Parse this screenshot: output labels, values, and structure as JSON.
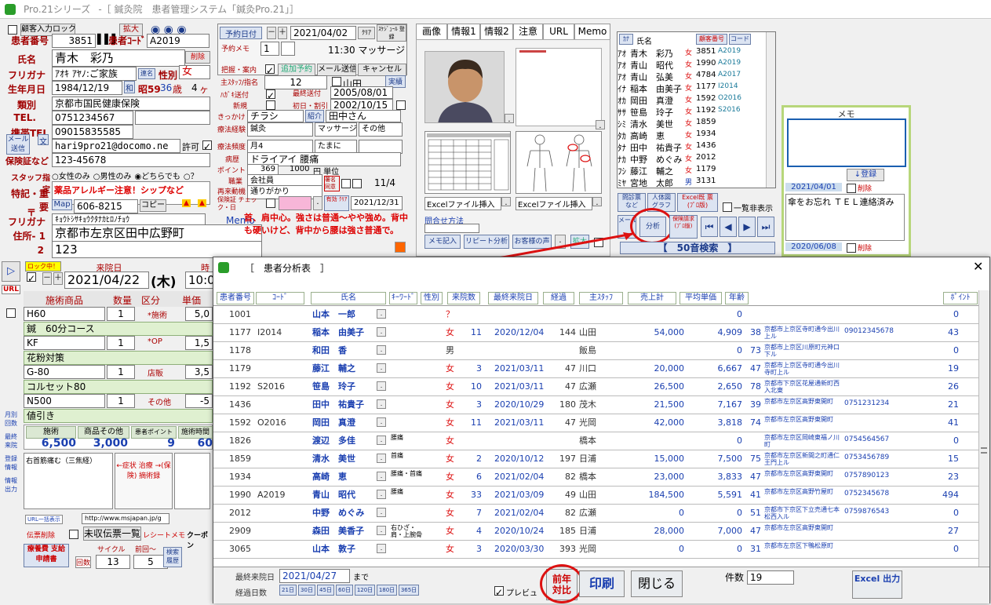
{
  "window": {
    "app": "Pro.21シリーズ",
    "title": "-［ 鍼灸院　患者管理システム「鍼灸Pro.21」］"
  },
  "patient": {
    "input_lock": "顧客入力ロック",
    "zoom": "拡大",
    "no_label": "患者番号",
    "no": "3851",
    "code_label": "患者ｺｰﾄﾞ",
    "code": "A2019",
    "name_label": "氏名",
    "name": "青木　彩乃",
    "delete": "削除",
    "kana_label": "フリガナ",
    "kana": "ｱｵｷ ｱﾔﾉ:ご家族",
    "family_btn": "連名",
    "sex_label": "性別",
    "sex": "女",
    "birth_label": "生年月日",
    "birth": "1984/12/19",
    "era_btn": "和",
    "era": "昭59",
    "age": "36",
    "age_unit": "歳",
    "months": "4",
    "month_unit": "ヶ月",
    "type_label": "類別",
    "type": "京都市国民健康保険",
    "tel_label": "TEL.",
    "tel": "0751234567",
    "mobile_label": "携帯TEL",
    "mobile": "09015835585",
    "mail_btn": "メール送信",
    "mail_btn2": "文",
    "mail": "hari9pro21@docomo.ne",
    "permit": "許可",
    "insurance_label": "保険証など",
    "insurance": "123-45678",
    "staff_label": "スタッフ指定",
    "staff_opts": [
      "女性のみ",
      "男性のみ",
      "どちらでも",
      "？"
    ],
    "special_label": "特記・重要",
    "special": "薬品アレルギー注意！シップなど",
    "zip_label": "〒",
    "map_btn": "Map",
    "zip": "606-8215",
    "copy_btn": "コピー",
    "kana2_label": "フリガナ",
    "kana2": "ｷｮｳﾄｼｻｷｮｳｸﾀﾅｶﾋﾛﾉﾁｮｳ",
    "memo_label": "Memo",
    "addr1_label": "住所- 1",
    "addr1": "京都市左京区田中広野町",
    "addr2_label": "2",
    "addr2": "123"
  },
  "reserve": {
    "date_btn": "予約日付",
    "minus": "－",
    "plus": "＋",
    "date": "2021/04/02",
    "clear": "ｸﾘｱ",
    "schedule": "ｽｹｼﾞｭｰﾙ 登録",
    "memo_label": "予約メモ",
    "memo_no": "1",
    "time_memo": "11:30 マッサージ",
    "guide_label": "把握・案内",
    "add_btn": "追加予約",
    "mail_btn": "メール送信",
    "cancel_btn": "キャンセル",
    "staff_label": "主ｽﾀｯﾌ/指名",
    "staff_no": "12",
    "staff": "山田",
    "real_btn": "実績",
    "hagaki_label": "ﾊｶﾞｷ送付",
    "last_sent_label": "最終送付",
    "last_sent": "2005/08/01",
    "new_label": "新規",
    "first_label": "初日・割引",
    "first_date": "2002/10/15",
    "trigger_label": "きっかけ",
    "trigger": "チラシ",
    "intro_btn": "紹介",
    "intro": "田中さん",
    "exp_label": "療法経験",
    "exp1": "鍼灸",
    "exp2": "マッサージ",
    "exp3": "その他",
    "freq_label": "療法頻度",
    "freq1": "月4",
    "freq2": "たまに",
    "disease_label": "病歴",
    "disease": "ドライアイ 腰痛",
    "point_label": "ポイント",
    "point": "369",
    "point_yen": "1000",
    "point_unit": "円 単位",
    "job_label": "職業",
    "job": "会社員",
    "revisit_label": "再来動機",
    "revisit": "通りがかり",
    "sign_label": "署名 同意",
    "sign_date": "11/4",
    "insure_label": "保険証 チェック・日",
    "valid_btn": "有効 ｸﾘｱ",
    "insure_date": "2021/12/31",
    "note": "首、肩中心。強さは普通～やや強め。背中も硬いけど、背中から腰は強さ普通で。"
  },
  "tabs": [
    "画像",
    "情報1",
    "情報2",
    "注意",
    "URL",
    "Memo"
  ],
  "image_panel": {
    "excel1": "Excelファイル挿入",
    "excel2": "Excelファイル挿入",
    "match_label": "問合せ方法",
    "memo_btn": "メモ記入",
    "repeat_btn": "リピート分析",
    "voice_btn": "お客様の声",
    "zoom_btn": "拡大"
  },
  "list_panel": {
    "kana_btn": "ｶﾅ",
    "name_col": "氏名",
    "cust_btn": "顧客番号",
    "code_btn": "コード",
    "rows": [
      {
        "k": "ｱｵ",
        "name": "青木　彩乃",
        "sex": "女",
        "no": "3851",
        "code": "A2019"
      },
      {
        "k": "ｱｵ",
        "name": "青山　昭代",
        "sex": "女",
        "no": "1990",
        "code": "A2019"
      },
      {
        "k": "ｱｵ",
        "name": "青山　弘美",
        "sex": "女",
        "no": "4784",
        "code": "A2017"
      },
      {
        "k": "ｲﾅ",
        "name": "稲本　由美子",
        "sex": "女",
        "no": "1177",
        "code": "I2014"
      },
      {
        "k": "ｵｶ",
        "name": "岡田　真澄",
        "sex": "女",
        "no": "1592",
        "code": "O2016"
      },
      {
        "k": "ｻｻ",
        "name": "笹島　玲子",
        "sex": "女",
        "no": "1192",
        "code": "S2016"
      },
      {
        "k": "ｼﾐ",
        "name": "清水　美世",
        "sex": "女",
        "no": "1859",
        "code": ""
      },
      {
        "k": "ﾀｶ",
        "name": "高崎　恵",
        "sex": "女",
        "no": "1934",
        "code": ""
      },
      {
        "k": "ﾀﾅ",
        "name": "田中　祐貴子",
        "sex": "女",
        "no": "1436",
        "code": ""
      },
      {
        "k": "ﾅｶ",
        "name": "中野　めぐみ",
        "sex": "女",
        "no": "2012",
        "code": ""
      },
      {
        "k": "ﾌｼ",
        "name": "藤江　輔之",
        "sex": "女",
        "no": "1179",
        "code": ""
      },
      {
        "k": "ﾐﾔ",
        "name": "宮地　太郎",
        "sex": "男",
        "no": "3131",
        "code": ""
      }
    ],
    "btn1": "問診票 など",
    "btn2": "人体図 グラフ",
    "btn3": "Excel既 票 (ﾌﾟﾛ版)",
    "hide_list": "一覧非表示",
    "btn4": "メール",
    "analysis": "分析",
    "btn5": "保険請求 (ﾌﾟﾛ版)",
    "search50": "【　50音検索　】"
  },
  "memo_panel": {
    "title": "メモ",
    "register": "↓登録",
    "date1": "2021/04/01",
    "del1": "削除",
    "text1": "傘をお忘れ ＴＥＬ連絡済み",
    "date2": "2020/06/08",
    "del2": "削除"
  },
  "visit": {
    "lock_btn": "ロック中！",
    "visit_label": "来院日",
    "date": "2021/04/22",
    "weekday": "(木)",
    "time_label": "時",
    "time": "10:0",
    "cols": [
      "施術商品",
      "数量",
      "区分",
      "単価"
    ],
    "items": [
      {
        "name": "H60",
        "qty": "1",
        "kind": "*施術",
        "price": "5,0"
      },
      {
        "name": "鍼　60分コース",
        "qty": "",
        "kind": "",
        "price": ""
      },
      {
        "name": "KF",
        "qty": "1",
        "kind": "*OP",
        "price": "1,5"
      },
      {
        "name": "花粉対策",
        "qty": "",
        "kind": "",
        "price": ""
      },
      {
        "name": "G-80",
        "qty": "1",
        "kind": "店販",
        "price": "3,5"
      },
      {
        "name": "コルセット80",
        "qty": "",
        "kind": "",
        "price": ""
      },
      {
        "name": "N500",
        "qty": "1",
        "kind": "その他",
        "price": "-5"
      },
      {
        "name": "値引き",
        "qty": "",
        "kind": "",
        "price": ""
      }
    ],
    "sum_labels": [
      "施術",
      "商品その他",
      "患者ポイント",
      "施術時間"
    ],
    "sums": [
      "6,500",
      "3,000",
      "9",
      "60"
    ],
    "sym_text": "右首筋痛む（三焦経）",
    "sym_btn": "←症状 治療 →(保険) 摘術録",
    "url_btn": "URL一括表示",
    "url": "http://www.msjapan.jp/g",
    "voucher_del": "伝票削除",
    "unpaid_btn": "未収伝票一覧",
    "receipt": "レシートメモ",
    "coupon": "クーポン",
    "cycle_label": "サイクル",
    "prev_label": "前回～",
    "cycle": "13",
    "prev": "5",
    "bill_btn": "療養費 支給申請書",
    "times": "回数",
    "search_btn": "検索 履歴"
  },
  "side_btns": [
    "URL",
    "月別 回数",
    "最終 来院",
    "登録 情報",
    "情報 出力"
  ],
  "dialog": {
    "title": "［　患者分析表　］",
    "headers": [
      "患者番号",
      "ｺｰﾄﾞ",
      "氏名",
      "ｷｰﾜｰﾄﾞ",
      "性別",
      "来院数",
      "最終来院日",
      "経過",
      "主ｽﾀｯﾌ",
      "売上計",
      "平均単価",
      "年齢",
      "",
      "ﾎﾟｲﾝﾄ"
    ],
    "rows": [
      {
        "no": "1001",
        "code": "",
        "name": "山本　一郎",
        "kw": "",
        "sex": "？",
        "cnt": "",
        "last": "",
        "elap": "",
        "staff": "",
        "sales": "",
        "avg": "0",
        "age": "",
        "addr": "",
        "tel": "",
        "pt": "0"
      },
      {
        "no": "1177",
        "code": "I2014",
        "name": "稲本　由美子",
        "kw": "",
        "sex": "女",
        "cnt": "11",
        "last": "2020/12/04",
        "elap": "144",
        "staff": "山田",
        "sales": "54,000",
        "avg": "4,909",
        "age": "38",
        "addr": "京都市上京区寺町通今出川上ル",
        "tel": "09012345678",
        "pt": "43"
      },
      {
        "no": "1178",
        "code": "",
        "name": "和田　香",
        "kw": "",
        "sex": "男",
        "cnt": "",
        "last": "",
        "elap": "",
        "staff": "飯島",
        "sales": "",
        "avg": "0",
        "age": "73",
        "addr": "京都市上京区川原町元神口下ル",
        "tel": "",
        "pt": "0"
      },
      {
        "no": "1179",
        "code": "",
        "name": "藤江　輔之",
        "kw": "",
        "sex": "女",
        "cnt": "3",
        "last": "2021/03/11",
        "elap": "47",
        "staff": "川口",
        "sales": "20,000",
        "avg": "6,667",
        "age": "47",
        "addr": "京都市上京区寺町通今出川寺町上ル",
        "tel": "",
        "pt": "19"
      },
      {
        "no": "1192",
        "code": "S2016",
        "name": "笹島　玲子",
        "kw": "",
        "sex": "女",
        "cnt": "10",
        "last": "2021/03/11",
        "elap": "47",
        "staff": "広瀬",
        "sales": "26,500",
        "avg": "2,650",
        "age": "78",
        "addr": "京都市下京区花屋通新町西入北東",
        "tel": "",
        "pt": "26"
      },
      {
        "no": "1436",
        "code": "",
        "name": "田中　祐貴子",
        "kw": "",
        "sex": "女",
        "cnt": "3",
        "last": "2020/10/29",
        "elap": "180",
        "staff": "茂木",
        "sales": "21,500",
        "avg": "7,167",
        "age": "39",
        "addr": "京都市左京区高野東開町",
        "tel": "0751231234",
        "pt": "21"
      },
      {
        "no": "1592",
        "code": "O2016",
        "name": "岡田　真澄",
        "kw": "",
        "sex": "女",
        "cnt": "11",
        "last": "2021/03/11",
        "elap": "47",
        "staff": "光岡",
        "sales": "42,000",
        "avg": "3,818",
        "age": "74",
        "addr": "京都市左京区高野東開町",
        "tel": "",
        "pt": "41"
      },
      {
        "no": "1826",
        "code": "",
        "name": "渡辺　多佳",
        "kw": "腰痛",
        "sex": "女",
        "cnt": "",
        "last": "",
        "elap": "",
        "staff": "橋本",
        "sales": "",
        "avg": "0",
        "age": "",
        "addr": "京都市左京区岡崎東福ノ川町",
        "tel": "0754564567",
        "pt": "0"
      },
      {
        "no": "1859",
        "code": "",
        "name": "清水　美世",
        "kw": "首痛",
        "sex": "女",
        "cnt": "2",
        "last": "2020/10/12",
        "elap": "197",
        "staff": "日浦",
        "sales": "15,000",
        "avg": "7,500",
        "age": "75",
        "addr": "京都市左京区新間之町通仁王門上ル",
        "tel": "0753456789",
        "pt": "15"
      },
      {
        "no": "1934",
        "code": "",
        "name": "高崎　恵",
        "kw": "腰痛・首痛",
        "sex": "女",
        "cnt": "6",
        "last": "2021/02/04",
        "elap": "82",
        "staff": "橋本",
        "sales": "23,000",
        "avg": "3,833",
        "age": "47",
        "addr": "京都市左京区高野東開町",
        "tel": "0757890123",
        "pt": "23"
      },
      {
        "no": "1990",
        "code": "A2019",
        "name": "青山　昭代",
        "kw": "腰痛",
        "sex": "女",
        "cnt": "33",
        "last": "2021/03/09",
        "elap": "49",
        "staff": "山田",
        "sales": "184,500",
        "avg": "5,591",
        "age": "41",
        "addr": "京都市左京区高野竹屋町",
        "tel": "0752345678",
        "pt": "494"
      },
      {
        "no": "2012",
        "code": "",
        "name": "中野　めぐみ",
        "kw": "",
        "sex": "女",
        "cnt": "7",
        "last": "2021/02/04",
        "elap": "82",
        "staff": "広瀬",
        "sales": "0",
        "avg": "0",
        "age": "51",
        "addr": "京都市下京区下立売通七本松西入ル",
        "tel": "0759876543",
        "pt": "0"
      },
      {
        "no": "2909",
        "code": "",
        "name": "森田　美香子",
        "kw": "右ひざ・肩・上腕骨",
        "sex": "女",
        "cnt": "4",
        "last": "2020/10/24",
        "elap": "185",
        "staff": "日浦",
        "sales": "28,000",
        "avg": "7,000",
        "age": "47",
        "addr": "京都市左京区高野東開町",
        "tel": "",
        "pt": "27"
      },
      {
        "no": "3065",
        "code": "",
        "name": "山本　敦子",
        "kw": "",
        "sex": "女",
        "cnt": "3",
        "last": "2020/03/30",
        "elap": "393",
        "staff": "光岡",
        "sales": "0",
        "avg": "0",
        "age": "31",
        "addr": "京都市左京区下鴨松原町",
        "tel": "",
        "pt": "0"
      }
    ],
    "last_visit_label": "最終来院日",
    "last_visit": "2021/04/27",
    "until": "まで",
    "elapsed_label": "経過日数",
    "day_btns": [
      "21日",
      "30日",
      "45日",
      "60日",
      "120日",
      "180日",
      "365日"
    ],
    "preview": "プレビュ",
    "compare": "前年 対比",
    "print": "印刷",
    "close": "閉じる",
    "count_label": "件数",
    "count": "19",
    "excel": "Excel 出力"
  }
}
